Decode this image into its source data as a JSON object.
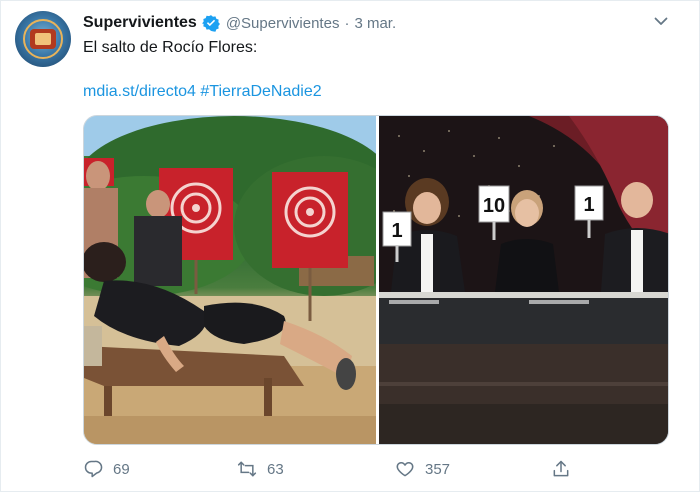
{
  "tweet": {
    "display_name": "Supervivientes",
    "handle": "@Supervivientes",
    "separator": "·",
    "date": "3 mar.",
    "text": "El salto de Rocío Flores:",
    "link": "mdia.st/directo4",
    "hashtag": "#TierraDeNadie2"
  },
  "media": {
    "left_image": "beach-jump-scene",
    "right_image": "judges-holding-score-cards",
    "score_cards": [
      "1",
      "10",
      "1"
    ]
  },
  "actions": {
    "reply_count": "69",
    "retweet_count": "63",
    "like_count": "357"
  },
  "colors": {
    "link": "#1b95e0",
    "verified": "#1da1f2",
    "muted": "#657786",
    "text": "#14171a"
  }
}
